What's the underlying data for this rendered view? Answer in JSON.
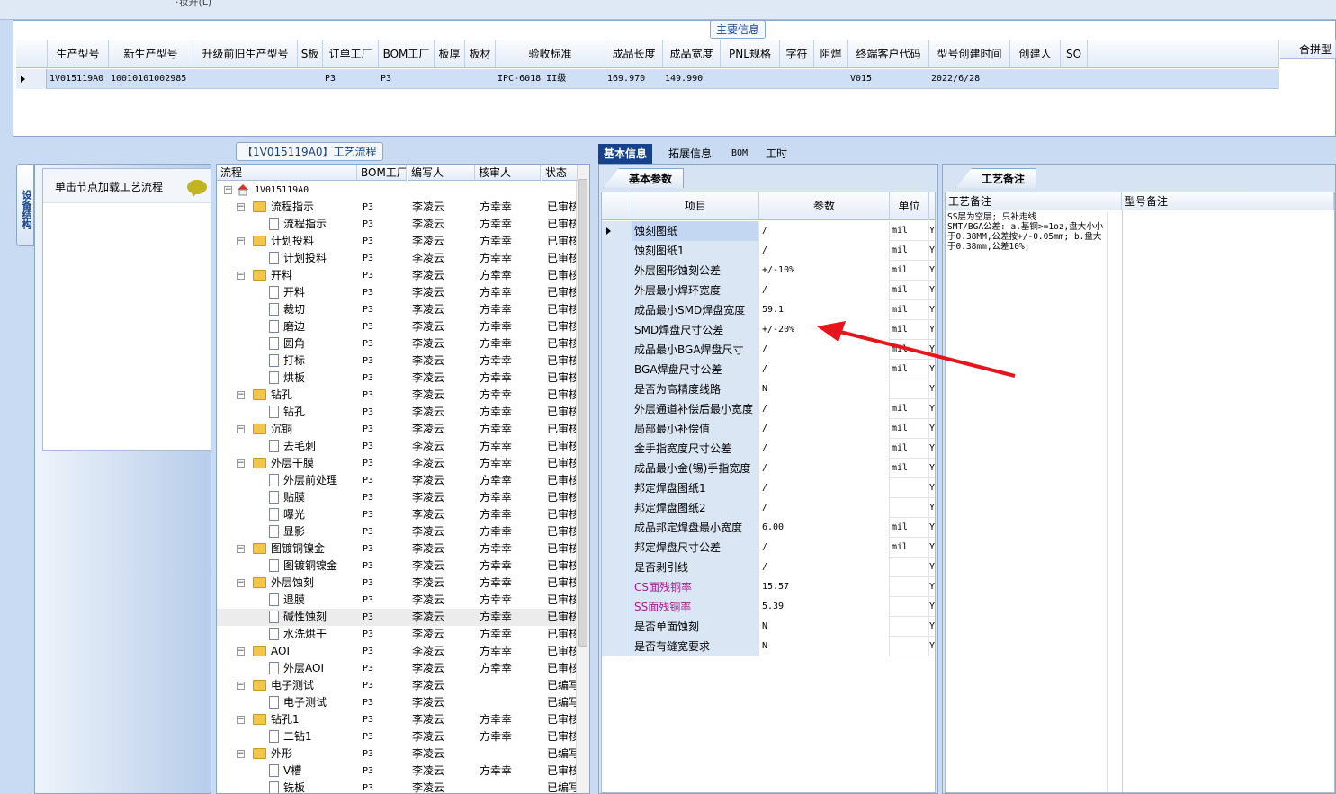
{
  "top": {
    "cut_text": "·妆开(L)"
  },
  "main_info": {
    "title": "主要信息",
    "columns": [
      "生产型号",
      "新生产型号",
      "升级前旧生产型号",
      "S板",
      "订单工厂",
      "BOM工厂",
      "板厚",
      "板材",
      "验收标准",
      "成品长度",
      "成品宽度",
      "PNL规格",
      "字符",
      "阻焊",
      "终端客户代码",
      "型号创建时间",
      "创建人",
      "SO"
    ],
    "row": {
      "生产型号": "1V015119A0",
      "新生产型号": "10010101002985",
      "升级前旧生产型号": "",
      "S板": "",
      "订单工厂": "P3",
      "BOM工厂": "P3",
      "板厚": "",
      "板材": "",
      "验收标准": "IPC-6018 II级",
      "成品长度": "169.970",
      "成品宽度": "149.990",
      "PNL规格": "",
      "字符": "",
      "阻焊": "",
      "终端客户代码": "V015",
      "型号创建时间": "2022/6/28",
      "创建人": "",
      "SO": ""
    },
    "right_header": "合拼型"
  },
  "left_tab": {
    "label": "设备结构"
  },
  "node_panel": {
    "hint": "单击节点加载工艺流程"
  },
  "flow": {
    "title": "【1V015119A0】工艺流程",
    "columns": [
      "流程",
      "BOM工厂",
      "编写人",
      "核审人",
      "状态"
    ],
    "rows": [
      {
        "level": 0,
        "type": "home",
        "name": "1V015119A0",
        "bom": "",
        "writer": "",
        "reviewer": "",
        "status": ""
      },
      {
        "level": 1,
        "type": "folder",
        "name": "流程指示",
        "bom": "P3",
        "writer": "李凌云",
        "reviewer": "方幸幸",
        "status": "已审核"
      },
      {
        "level": 2,
        "type": "doc",
        "name": "流程指示",
        "bom": "P3",
        "writer": "李凌云",
        "reviewer": "方幸幸",
        "status": "已审核"
      },
      {
        "level": 1,
        "type": "folder",
        "name": "计划投料",
        "bom": "P3",
        "writer": "李凌云",
        "reviewer": "方幸幸",
        "status": "已审核"
      },
      {
        "level": 2,
        "type": "doc",
        "name": "计划投料",
        "bom": "P3",
        "writer": "李凌云",
        "reviewer": "方幸幸",
        "status": "已审核"
      },
      {
        "level": 1,
        "type": "folder",
        "name": "开料",
        "bom": "P3",
        "writer": "李凌云",
        "reviewer": "方幸幸",
        "status": "已审核"
      },
      {
        "level": 2,
        "type": "doc",
        "name": "开料",
        "bom": "P3",
        "writer": "李凌云",
        "reviewer": "方幸幸",
        "status": "已审核"
      },
      {
        "level": 2,
        "type": "doc",
        "name": "裁切",
        "bom": "P3",
        "writer": "李凌云",
        "reviewer": "方幸幸",
        "status": "已审核"
      },
      {
        "level": 2,
        "type": "doc",
        "name": "磨边",
        "bom": "P3",
        "writer": "李凌云",
        "reviewer": "方幸幸",
        "status": "已审核"
      },
      {
        "level": 2,
        "type": "doc",
        "name": "圆角",
        "bom": "P3",
        "writer": "李凌云",
        "reviewer": "方幸幸",
        "status": "已审核"
      },
      {
        "level": 2,
        "type": "doc",
        "name": "打标",
        "bom": "P3",
        "writer": "李凌云",
        "reviewer": "方幸幸",
        "status": "已审核"
      },
      {
        "level": 2,
        "type": "doc",
        "name": "烘板",
        "bom": "P3",
        "writer": "李凌云",
        "reviewer": "方幸幸",
        "status": "已审核"
      },
      {
        "level": 1,
        "type": "folder",
        "name": "钻孔",
        "bom": "P3",
        "writer": "李凌云",
        "reviewer": "方幸幸",
        "status": "已审核"
      },
      {
        "level": 2,
        "type": "doc",
        "name": "钻孔",
        "bom": "P3",
        "writer": "李凌云",
        "reviewer": "方幸幸",
        "status": "已审核"
      },
      {
        "level": 1,
        "type": "folder",
        "name": "沉铜",
        "bom": "P3",
        "writer": "李凌云",
        "reviewer": "方幸幸",
        "status": "已审核"
      },
      {
        "level": 2,
        "type": "doc",
        "name": "去毛刺",
        "bom": "P3",
        "writer": "李凌云",
        "reviewer": "方幸幸",
        "status": "已审核"
      },
      {
        "level": 1,
        "type": "folder",
        "name": "外层干膜",
        "bom": "P3",
        "writer": "李凌云",
        "reviewer": "方幸幸",
        "status": "已审核"
      },
      {
        "level": 2,
        "type": "doc",
        "name": "外层前处理",
        "bom": "P3",
        "writer": "李凌云",
        "reviewer": "方幸幸",
        "status": "已审核"
      },
      {
        "level": 2,
        "type": "doc",
        "name": "贴膜",
        "bom": "P3",
        "writer": "李凌云",
        "reviewer": "方幸幸",
        "status": "已审核"
      },
      {
        "level": 2,
        "type": "doc",
        "name": "曝光",
        "bom": "P3",
        "writer": "李凌云",
        "reviewer": "方幸幸",
        "status": "已审核"
      },
      {
        "level": 2,
        "type": "doc",
        "name": "显影",
        "bom": "P3",
        "writer": "李凌云",
        "reviewer": "方幸幸",
        "status": "已审核"
      },
      {
        "level": 1,
        "type": "folder",
        "name": "图镀铜镍金",
        "bom": "P3",
        "writer": "李凌云",
        "reviewer": "方幸幸",
        "status": "已审核"
      },
      {
        "level": 2,
        "type": "doc",
        "name": "图镀铜镍金",
        "bom": "P3",
        "writer": "李凌云",
        "reviewer": "方幸幸",
        "status": "已审核"
      },
      {
        "level": 1,
        "type": "folder",
        "name": "外层蚀刻",
        "bom": "P3",
        "writer": "李凌云",
        "reviewer": "方幸幸",
        "status": "已审核"
      },
      {
        "level": 2,
        "type": "doc",
        "name": "退膜",
        "bom": "P3",
        "writer": "李凌云",
        "reviewer": "方幸幸",
        "status": "已审核"
      },
      {
        "level": 2,
        "type": "doc",
        "name": "碱性蚀刻",
        "bom": "P3",
        "writer": "李凌云",
        "reviewer": "方幸幸",
        "status": "已审核"
      },
      {
        "level": 2,
        "type": "doc",
        "name": "水洗烘干",
        "bom": "P3",
        "writer": "李凌云",
        "reviewer": "方幸幸",
        "status": "已审核"
      },
      {
        "level": 1,
        "type": "folder",
        "name": "AOI",
        "bom": "P3",
        "writer": "李凌云",
        "reviewer": "方幸幸",
        "status": "已审核"
      },
      {
        "level": 2,
        "type": "doc",
        "name": "外层AOI",
        "bom": "P3",
        "writer": "李凌云",
        "reviewer": "方幸幸",
        "status": "已审核"
      },
      {
        "level": 1,
        "type": "folder",
        "name": "电子测试",
        "bom": "P3",
        "writer": "李凌云",
        "reviewer": "",
        "status": "已编写"
      },
      {
        "level": 2,
        "type": "doc",
        "name": "电子测试",
        "bom": "P3",
        "writer": "李凌云",
        "reviewer": "",
        "status": "已编写"
      },
      {
        "level": 1,
        "type": "folder",
        "name": "钻孔1",
        "bom": "P3",
        "writer": "李凌云",
        "reviewer": "方幸幸",
        "status": "已审核"
      },
      {
        "level": 2,
        "type": "doc",
        "name": "二钻1",
        "bom": "P3",
        "writer": "李凌云",
        "reviewer": "方幸幸",
        "status": "已审核"
      },
      {
        "level": 1,
        "type": "folder",
        "name": "外形",
        "bom": "P3",
        "writer": "李凌云",
        "reviewer": "",
        "status": "已编写"
      },
      {
        "level": 2,
        "type": "doc",
        "name": "V槽",
        "bom": "P3",
        "writer": "李凌云",
        "reviewer": "方幸幸",
        "status": "已审核"
      },
      {
        "level": 2,
        "type": "doc",
        "name": "铣板",
        "bom": "P3",
        "writer": "李凌云",
        "reviewer": "",
        "status": "已编写"
      }
    ]
  },
  "tabs": [
    "基本信息",
    "拓展信息",
    "BOM",
    "工时"
  ],
  "basic": {
    "subtab": "基本参数",
    "columns": [
      "项目",
      "参数",
      "单位"
    ],
    "rows": [
      {
        "item": "蚀刻图纸",
        "value": "/",
        "unit": "mil",
        "flag": "Y",
        "color": "#000000"
      },
      {
        "item": "蚀刻图纸1",
        "value": "/",
        "unit": "mil",
        "flag": "Y",
        "color": "#000000"
      },
      {
        "item": "外层图形蚀刻公差",
        "value": "+/-10%",
        "unit": "mil",
        "flag": "Y",
        "color": "#000000"
      },
      {
        "item": "外层最小焊环宽度",
        "value": "/",
        "unit": "mil",
        "flag": "Y",
        "color": "#000000"
      },
      {
        "item": "成品最小SMD焊盘宽度",
        "value": "59.1",
        "unit": "mil",
        "flag": "Y",
        "color": "#000000"
      },
      {
        "item": "SMD焊盘尺寸公差",
        "value": "+/-20%",
        "unit": "mil",
        "flag": "Y",
        "color": "#000000"
      },
      {
        "item": "成品最小BGA焊盘尺寸",
        "value": "/",
        "unit": "mil",
        "flag": "Y",
        "color": "#000000"
      },
      {
        "item": "BGA焊盘尺寸公差",
        "value": "/",
        "unit": "mil",
        "flag": "Y",
        "color": "#000000"
      },
      {
        "item": "是否为高精度线路",
        "value": "N",
        "unit": "",
        "flag": "Y",
        "color": "#000000"
      },
      {
        "item": "外层通道补偿后最小宽度",
        "value": "/",
        "unit": "mil",
        "flag": "Y",
        "color": "#000000"
      },
      {
        "item": "局部最小补偿值",
        "value": "/",
        "unit": "mil",
        "flag": "Y",
        "color": "#000000"
      },
      {
        "item": "金手指宽度尺寸公差",
        "value": "/",
        "unit": "mil",
        "flag": "Y",
        "color": "#000000"
      },
      {
        "item": "成品最小金(锡)手指宽度",
        "value": "/",
        "unit": "mil",
        "flag": "Y",
        "color": "#000000"
      },
      {
        "item": "邦定焊盘图纸1",
        "value": "/",
        "unit": "",
        "flag": "Y",
        "color": "#000000"
      },
      {
        "item": "邦定焊盘图纸2",
        "value": "/",
        "unit": "",
        "flag": "Y",
        "color": "#000000"
      },
      {
        "item": "成品邦定焊盘最小宽度",
        "value": "6.00",
        "unit": "mil",
        "flag": "Y",
        "color": "#000000"
      },
      {
        "item": "邦定焊盘尺寸公差",
        "value": "/",
        "unit": "mil",
        "flag": "Y",
        "color": "#000000"
      },
      {
        "item": "是否剥引线",
        "value": "/",
        "unit": "",
        "flag": "Y",
        "color": "#000000"
      },
      {
        "item": "CS面残铜率",
        "value": "15.57",
        "unit": "",
        "flag": "Y",
        "color": "#a0208c"
      },
      {
        "item": "SS面残铜率",
        "value": "5.39",
        "unit": "",
        "flag": "Y",
        "color": "#a0208c"
      },
      {
        "item": "是否单面蚀刻",
        "value": "N",
        "unit": "",
        "flag": "Y",
        "color": "#000000"
      },
      {
        "item": "是否有缝宽要求",
        "value": "N",
        "unit": "",
        "flag": "Y",
        "color": "#000000"
      }
    ]
  },
  "notes": {
    "subtab": "工艺备注",
    "col1": "工艺备注",
    "col2": "型号备注",
    "text": "SS层为空层; 只补走线\nSMT/BGA公差: a.基铜>=1oz,盘大小小于0.38MM,公差按+/-0.05mm; b.盘大于0.38mm,公差10%;"
  },
  "colors": {
    "accent": "#15428b",
    "selection": "#cfe0f6",
    "annotation_arrow": "#e8141c"
  }
}
